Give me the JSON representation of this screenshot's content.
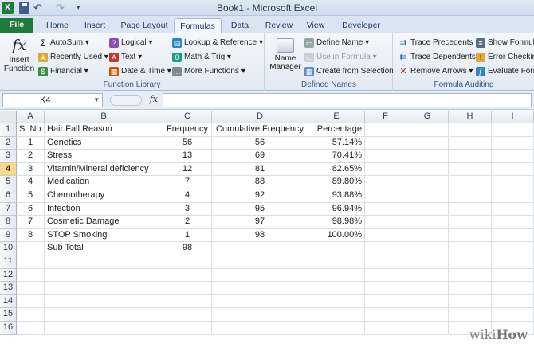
{
  "window": {
    "title": "Book1  -  Microsoft Excel"
  },
  "quick_access": {
    "app_icon": "X",
    "undo": "↶",
    "redo": "↷",
    "customize": "▾"
  },
  "tabs": [
    "File",
    "Home",
    "Insert",
    "Page Layout",
    "Formulas",
    "Data",
    "Review",
    "View",
    "Developer"
  ],
  "active_tab": "Formulas",
  "ribbon": {
    "function_library": {
      "label": "Function Library",
      "insert_function": "Insert Function",
      "insert_function_line1": "Insert",
      "insert_function_line2": "Function",
      "autosum": "AutoSum",
      "recently_used": "Recently Used",
      "financial": "Financial",
      "logical": "Logical",
      "text": "Text",
      "date_time": "Date & Time",
      "lookup_reference": "Lookup & Reference",
      "math_trig": "Math & Trig",
      "more_functions": "More Functions"
    },
    "defined_names": {
      "label": "Defined Names",
      "name_manager_line1": "Name",
      "name_manager_line2": "Manager",
      "define_name": "Define Name",
      "use_in_formula": "Use in Formula",
      "create_from_selection": "Create from Selection"
    },
    "formula_auditing": {
      "label": "Formula Auditing",
      "trace_precedents": "Trace Precedents",
      "trace_dependents": "Trace Dependents",
      "remove_arrows": "Remove Arrows",
      "show_formulas": "Show Formul",
      "error_checking": "Error Checkin",
      "evaluate_formula": "Evaluate Form"
    }
  },
  "formula_bar": {
    "name_box": "K4",
    "fx": "fx",
    "formula": ""
  },
  "grid": {
    "columns": [
      "A",
      "B",
      "C",
      "D",
      "E",
      "F",
      "G",
      "H",
      "I"
    ],
    "rows": [
      "1",
      "2",
      "3",
      "4",
      "5",
      "6",
      "7",
      "8",
      "9",
      "10",
      "11",
      "12",
      "13",
      "14",
      "15",
      "16"
    ],
    "selected_row": "4",
    "data": [
      [
        "S. No.",
        "Hair Fall Reason",
        "Frequency",
        "Cumulative Frequency",
        "Percentage"
      ],
      [
        "1",
        "Genetics",
        "56",
        "56",
        "57.14%"
      ],
      [
        "2",
        "Stress",
        "13",
        "69",
        "70.41%"
      ],
      [
        "3",
        "Vitamin/Mineral deficiency",
        "12",
        "81",
        "82.65%"
      ],
      [
        "4",
        "Medication",
        "7",
        "88",
        "89.80%"
      ],
      [
        "5",
        "Chemotherapy",
        "4",
        "92",
        "93.88%"
      ],
      [
        "6",
        "Infection",
        "3",
        "95",
        "96.94%"
      ],
      [
        "7",
        "Cosmetic Damage",
        "2",
        "97",
        "98.98%"
      ],
      [
        "8",
        "STOP Smoking",
        "1",
        "98",
        "100.00%"
      ],
      [
        "",
        "Sub Total",
        "98",
        "",
        ""
      ]
    ]
  },
  "watermark": {
    "wiki": "wiki",
    "how": "How"
  },
  "colors": {
    "file_tab": "#1f7a3c",
    "selected_row": "#f9d98b",
    "ribbon": "#dbe5f1"
  }
}
